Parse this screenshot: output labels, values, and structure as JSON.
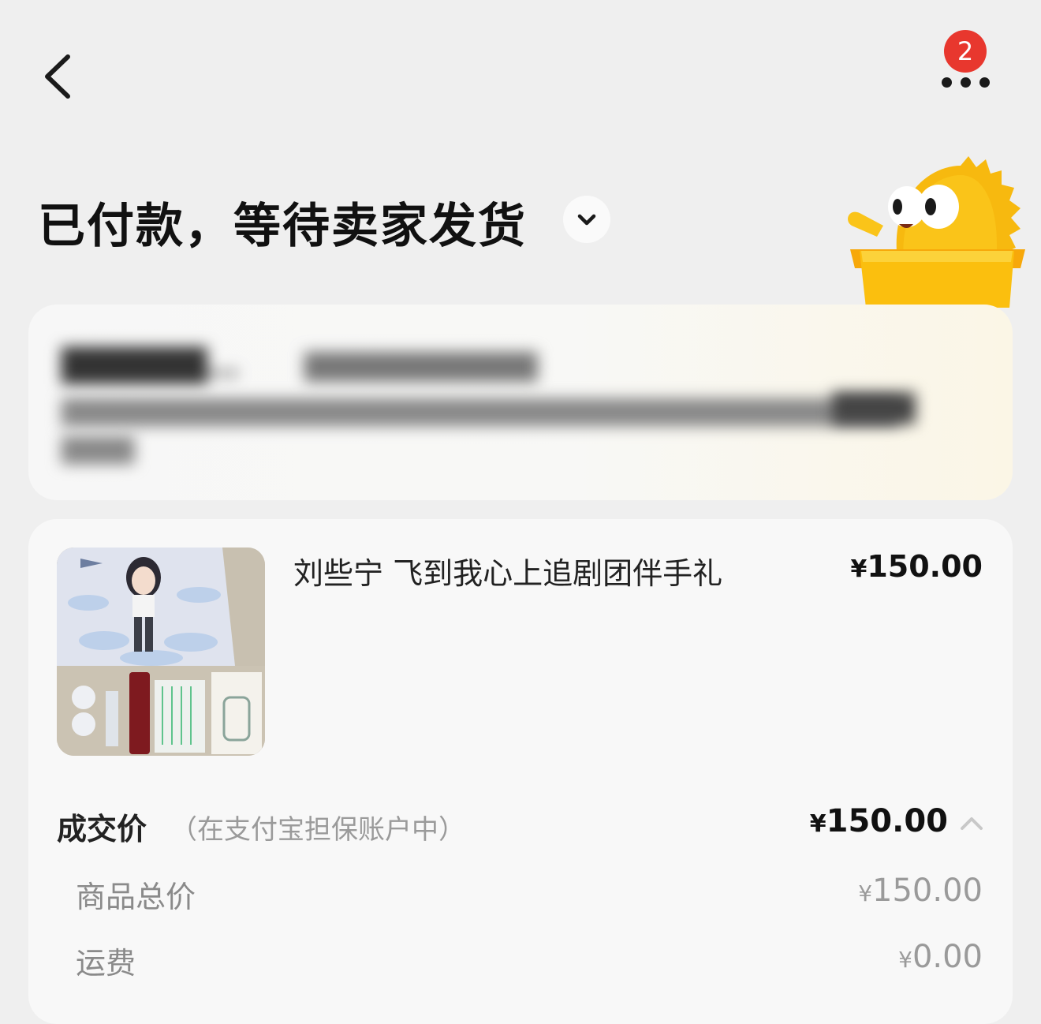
{
  "header": {
    "back_icon": "chevron-left-icon",
    "more_icon": "more-dots-icon",
    "badge_count": "2"
  },
  "status": {
    "title": "已付款，等待卖家发货",
    "toggle_icon": "chevron-down-icon"
  },
  "product": {
    "title": "刘些宁 飞到我心上追剧团伴手礼",
    "price_symbol": "¥",
    "price": "150.00"
  },
  "payment": {
    "deal_label": "成交价",
    "deal_note": "（在支付宝担保账户中）",
    "deal_symbol": "¥",
    "deal_price": "150.00",
    "collapse_icon": "chevron-up-icon",
    "rows": [
      {
        "label": "商品总价",
        "symbol": "¥",
        "value": "150.00"
      },
      {
        "label": "运费",
        "symbol": "¥",
        "value": "0.00"
      }
    ]
  },
  "colors": {
    "badge": "#e8372e",
    "mascot": "#f7b90f",
    "background": "#efefef"
  }
}
